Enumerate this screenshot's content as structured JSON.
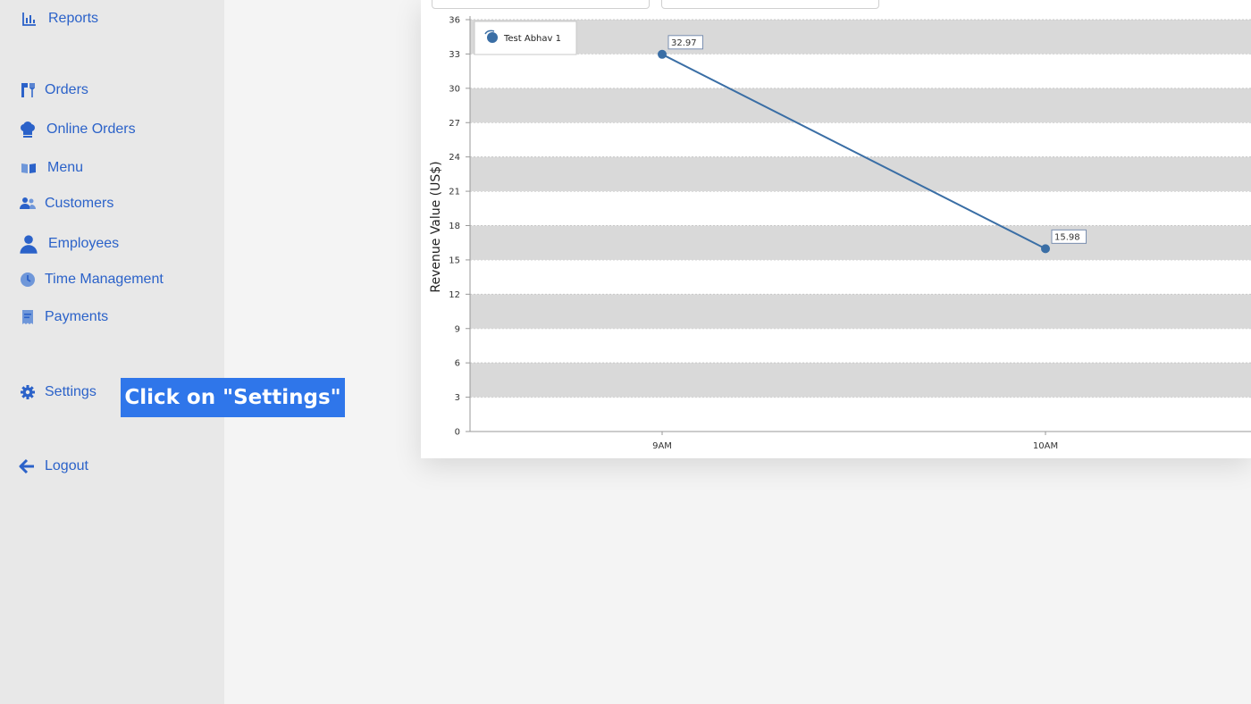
{
  "sidebar": {
    "items": [
      {
        "label": "Reports",
        "icon": "bar-chart-icon"
      },
      {
        "label": "Orders",
        "icon": "cutlery-icon"
      },
      {
        "label": "Online Orders",
        "icon": "chef-hat-icon"
      },
      {
        "label": "Menu",
        "icon": "book-icon"
      },
      {
        "label": "Customers",
        "icon": "users-icon"
      },
      {
        "label": "Employees",
        "icon": "user-icon"
      },
      {
        "label": "Time Management",
        "icon": "clock-icon"
      },
      {
        "label": "Payments",
        "icon": "receipt-icon"
      },
      {
        "label": "Settings",
        "icon": "gear-icon"
      },
      {
        "label": "Logout",
        "icon": "arrow-left-icon"
      }
    ]
  },
  "tooltip": {
    "text": "Click on \"Settings\""
  },
  "colors": {
    "accent": "#2b62c9",
    "tooltip_bg": "#2f76ea",
    "series": "#3a6ea5",
    "band": "#d9d9d9"
  },
  "chart_data": {
    "type": "line",
    "categories": [
      "9AM",
      "10AM"
    ],
    "series": [
      {
        "name": "Test Abhav 1",
        "values": [
          32.97,
          15.98
        ]
      }
    ],
    "data_labels": [
      "32.97",
      "15.98"
    ],
    "ylabel": "Revenue Value (US$)",
    "xlabel": "",
    "ylim": [
      0,
      36
    ],
    "yticks": [
      0,
      3,
      6,
      9,
      12,
      15,
      18,
      21,
      24,
      27,
      30,
      33,
      36
    ],
    "grid": "alternating horizontal bands",
    "legend_position": "top-left"
  }
}
